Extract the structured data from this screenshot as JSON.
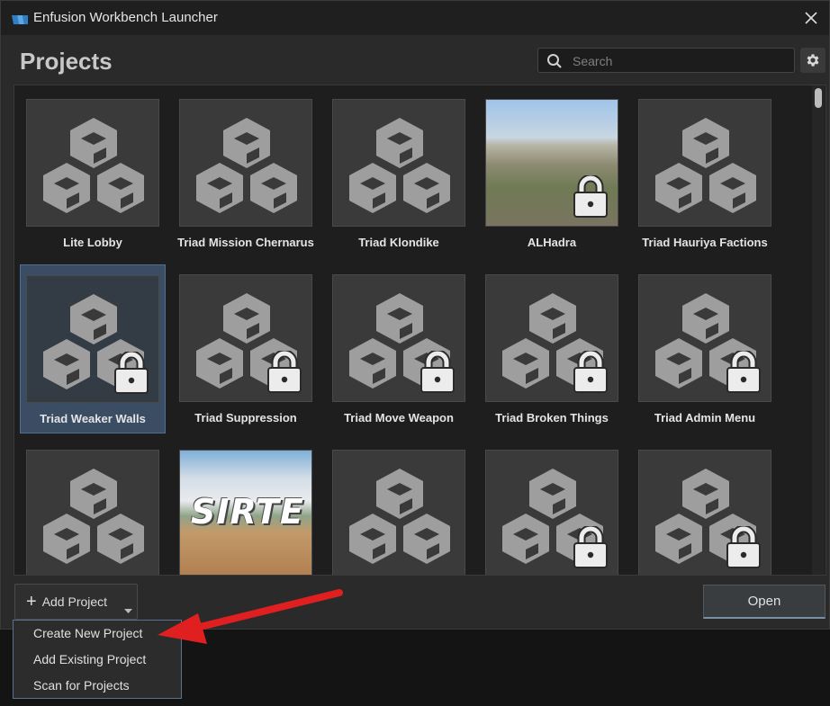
{
  "window": {
    "title": "Enfusion Workbench Launcher"
  },
  "heading": "Projects",
  "search": {
    "placeholder": "Search",
    "value": ""
  },
  "projects": [
    {
      "label": "Lite Lobby",
      "thumbnail": "cubes-icon",
      "locked": false,
      "selected": false
    },
    {
      "label": "Triad Mission Chernarus",
      "thumbnail": "cubes-icon",
      "locked": false,
      "selected": false
    },
    {
      "label": "Triad Klondike",
      "thumbnail": "cubes-icon",
      "locked": false,
      "selected": false
    },
    {
      "label": "ALHadra",
      "thumbnail": "city-aerial-photo",
      "locked": true,
      "selected": false
    },
    {
      "label": "Triad Hauriya Factions",
      "thumbnail": "cubes-icon",
      "locked": false,
      "selected": false
    },
    {
      "label": "Triad Weaker Walls",
      "thumbnail": "cubes-icon",
      "locked": true,
      "selected": true
    },
    {
      "label": "Triad Suppression",
      "thumbnail": "cubes-icon",
      "locked": true,
      "selected": false
    },
    {
      "label": "Triad Move Weapon",
      "thumbnail": "cubes-icon",
      "locked": true,
      "selected": false
    },
    {
      "label": "Triad Broken Things",
      "thumbnail": "cubes-icon",
      "locked": true,
      "selected": false
    },
    {
      "label": "Triad Admin Menu",
      "thumbnail": "cubes-icon",
      "locked": true,
      "selected": false
    },
    {
      "label": "",
      "thumbnail": "cubes-icon",
      "locked": false,
      "selected": false
    },
    {
      "label": "",
      "thumbnail": "sirte-photo",
      "image_text": "SIRTE",
      "locked": false,
      "selected": false
    },
    {
      "label": "",
      "thumbnail": "cubes-icon",
      "locked": false,
      "selected": false
    },
    {
      "label": "",
      "thumbnail": "cubes-icon",
      "locked": true,
      "selected": false
    },
    {
      "label": "",
      "thumbnail": "cubes-icon",
      "locked": true,
      "selected": false
    }
  ],
  "buttons": {
    "add_project": "Add Project",
    "open": "Open"
  },
  "add_menu": {
    "items": [
      "Create New Project",
      "Add Existing Project",
      "Scan for Projects"
    ]
  },
  "colors": {
    "selected_card": "#3a4d63",
    "annotation_arrow": "#e02020"
  }
}
